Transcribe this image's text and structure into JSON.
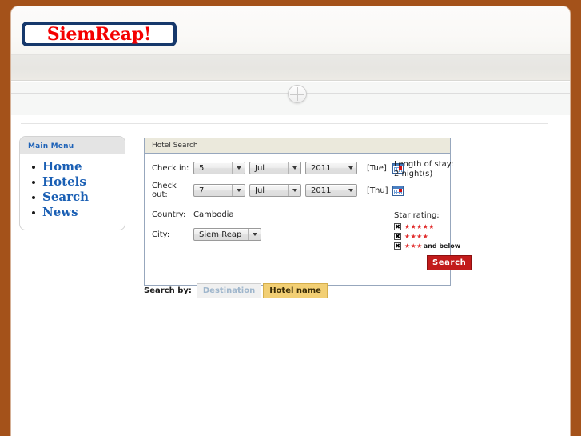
{
  "site": {
    "logo_text": "SiemReap!",
    "background_color": "#a4521a",
    "logo_border_color": "#16386b",
    "logo_text_color": "#f40000"
  },
  "sidebar": {
    "title": "Main Menu",
    "items": [
      {
        "label": "Home"
      },
      {
        "label": "Hotels"
      },
      {
        "label": "Search"
      },
      {
        "label": "News"
      }
    ]
  },
  "search_panel": {
    "title": "Hotel Search",
    "check_in": {
      "label": "Check in:",
      "day": "5",
      "month": "Jul",
      "year": "2011",
      "weekday": "[Tue]"
    },
    "check_out": {
      "label": "Check out:",
      "day": "7",
      "month": "Jul",
      "year": "2011",
      "weekday": "[Thu]"
    },
    "stay": {
      "label": "Length of stay:",
      "value": "2 night(s)"
    },
    "country": {
      "label": "Country:",
      "value": "Cambodia"
    },
    "city": {
      "label": "City:",
      "value": "Siem Reap"
    },
    "star_rating": {
      "label": "Star rating:",
      "checkbox_mark": "✖",
      "star_color": "#e02b2b",
      "options": [
        {
          "stars": "★★★★★",
          "note": "",
          "checked": true
        },
        {
          "stars": "★★★★",
          "note": "",
          "checked": true
        },
        {
          "stars": "★★★",
          "note": "and below",
          "checked": true
        }
      ]
    },
    "search_button": {
      "label": "Search",
      "color": "#c21b1b"
    }
  },
  "search_by": {
    "label": "Search by:",
    "tabs": [
      {
        "label": "Destination",
        "active": false
      },
      {
        "label": "Hotel name",
        "active": true
      }
    ]
  }
}
